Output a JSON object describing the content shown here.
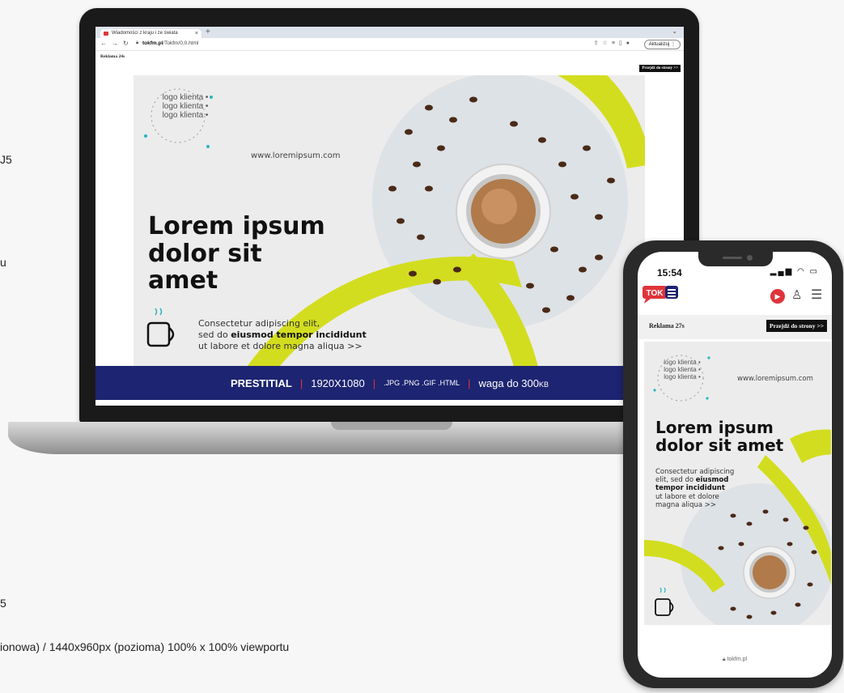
{
  "background_text": {
    "line1": "J5",
    "line2": "u",
    "line3": "5",
    "line4": "ionowa) / 1440x960px (pozioma) 100% x 100% viewportu"
  },
  "browser": {
    "tab_title": "Wiadomości z kraju i ze świata",
    "tab_close": "×",
    "new_tab": "+",
    "tabs_menu": "⌄",
    "url_domain": "tokfm.pl",
    "url_path": "/Tokfm/0,0.html",
    "update_button": "Aktualizuj",
    "update_more": "⋮"
  },
  "ad": {
    "label_desktop": "Reklama 24s",
    "skip_desktop": "Przejdź do strony >>",
    "label_mobile": "Reklama 27s",
    "skip_mobile": "Przejdź do strony >>"
  },
  "banner": {
    "logo_text": "logo klienta • logo klienta • logo klienta •",
    "website": "www.loremipsum.com",
    "headline_lines": [
      "Lorem ipsum",
      "dolor sit",
      "amet"
    ],
    "headline_mobile_lines": [
      "Lorem ipsum",
      "dolor sit amet"
    ],
    "body_prefix": "Consectetur adipiscing elit,",
    "body_mid1": "sed do ",
    "body_bold": "eiusmod tempor incididunt",
    "body_line3": "ut labore et dolore magna aliqua   >>",
    "mobile_body_l1": "Consectetur adipiscing",
    "mobile_body_l2": "elit, sed do ",
    "mobile_body_bold1": "eiusmod",
    "mobile_body_bold2": "tempor incididunt",
    "mobile_body_l4": "ut labore et dolore",
    "mobile_body_l5": "magna aliqua   >>"
  },
  "spec_bar": {
    "format": "PRESTITIAL",
    "size": "1920X1080",
    "types": ".JPG .PNG .GIF .HTML",
    "weight_prefix": "waga do 300",
    "weight_unit": "KB",
    "sep": "|"
  },
  "phone": {
    "time": "15:54",
    "status": "▂▄▆ ◠ ▭",
    "logo": "TOK",
    "footer_url": "tokfm.pl"
  },
  "colors": {
    "accent_lime": "#d3dd1f",
    "navy": "#1d2471",
    "brand_red": "#e0343c",
    "teal": "#2bb3c0"
  }
}
